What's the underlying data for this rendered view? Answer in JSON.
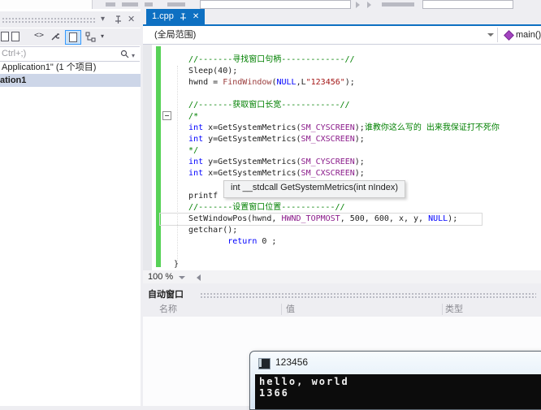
{
  "solution_explorer": {
    "search_placeholder": "Ctrl+;)",
    "tree_item_1": "Application1\" (1 个项目)",
    "tree_item_2": "ation1"
  },
  "editor": {
    "tab_label": "1.cpp",
    "scope_dropdown": "(全局范围)",
    "member_dropdown": "main()",
    "zoom_level": "100 %",
    "tooltip": "int __stdcall GetSystemMetrics(int nIndex)",
    "code_lines": [
      {
        "seg": [
          {
            "c": "c",
            "t": "   //-------寻找窗口句柄-------------//"
          }
        ]
      },
      {
        "seg": [
          {
            "c": "p",
            "t": "   Sleep(40);"
          }
        ]
      },
      {
        "seg": [
          {
            "c": "p",
            "t": "   hwnd = "
          },
          {
            "c": "f",
            "t": "FindWindow"
          },
          {
            "c": "p",
            "t": "("
          },
          {
            "c": "k",
            "t": "NULL"
          },
          {
            "c": "p",
            "t": ",L"
          },
          {
            "c": "s",
            "t": "\"123456\""
          },
          {
            "c": "p",
            "t": ");"
          }
        ]
      },
      {
        "seg": []
      },
      {
        "seg": [
          {
            "c": "c",
            "t": "   //-------获取窗口长宽------------//"
          }
        ]
      },
      {
        "seg": [
          {
            "c": "c",
            "t": "   /*"
          }
        ]
      },
      {
        "seg": [
          {
            "c": "k",
            "t": "   int"
          },
          {
            "c": "p",
            "t": " x=GetSystemMetrics("
          },
          {
            "c": "m",
            "t": "SM_CYSCREEN"
          },
          {
            "c": "p",
            "t": ");"
          },
          {
            "c": "c",
            "t": "谁教你这么写的 出来我保证打不死你"
          }
        ]
      },
      {
        "seg": [
          {
            "c": "k",
            "t": "   int"
          },
          {
            "c": "p",
            "t": " y=GetSystemMetrics("
          },
          {
            "c": "m",
            "t": "SM_CXSCREEN"
          },
          {
            "c": "p",
            "t": ");"
          }
        ]
      },
      {
        "seg": [
          {
            "c": "c",
            "t": "   */"
          }
        ]
      },
      {
        "seg": [
          {
            "c": "k",
            "t": "   int"
          },
          {
            "c": "p",
            "t": " y=GetSystemMetrics("
          },
          {
            "c": "m",
            "t": "SM_CYSCREEN"
          },
          {
            "c": "p",
            "t": ");"
          }
        ]
      },
      {
        "seg": [
          {
            "c": "k",
            "t": "   int"
          },
          {
            "c": "p",
            "t": " x=GetSystemMetrics("
          },
          {
            "c": "m",
            "t": "SM_CXSCREEN"
          },
          {
            "c": "p",
            "t": ");"
          }
        ]
      },
      {
        "seg": []
      },
      {
        "seg": [
          {
            "c": "p",
            "t": "   printf"
          }
        ]
      },
      {
        "seg": [
          {
            "c": "c",
            "t": "   //-------设置窗口位置-----------//"
          }
        ]
      },
      {
        "boxed": true,
        "seg": [
          {
            "c": "p",
            "t": "   SetWindowPos(hwnd, "
          },
          {
            "c": "m",
            "t": "HWND_TOPMOST"
          },
          {
            "c": "p",
            "t": ", 500, 600, x, y, "
          },
          {
            "c": "k",
            "t": "NULL"
          },
          {
            "c": "p",
            "t": ");"
          }
        ]
      },
      {
        "seg": [
          {
            "c": "p",
            "t": "   getchar();"
          }
        ]
      },
      {
        "seg": [
          {
            "c": "k",
            "t": "           return"
          },
          {
            "c": "p",
            "t": " 0 ;"
          }
        ]
      },
      {
        "seg": []
      },
      {
        "seg": [
          {
            "c": "p",
            "t": "}"
          }
        ]
      }
    ]
  },
  "autos": {
    "title": "自动窗口",
    "col_name": "名称",
    "col_value": "值",
    "col_type": "类型"
  },
  "console": {
    "title": "123456",
    "line1": "hello, world",
    "line2": "1366"
  },
  "colors": {
    "tab_active": "#0e70c2",
    "comment": "#008000",
    "keyword": "#0000ff",
    "macro": "#8b1c8b",
    "string": "#a31515",
    "function_name": "#9a3b3b",
    "change_bar_green": "#57d257",
    "selection_bg": "#cdd6e8"
  }
}
